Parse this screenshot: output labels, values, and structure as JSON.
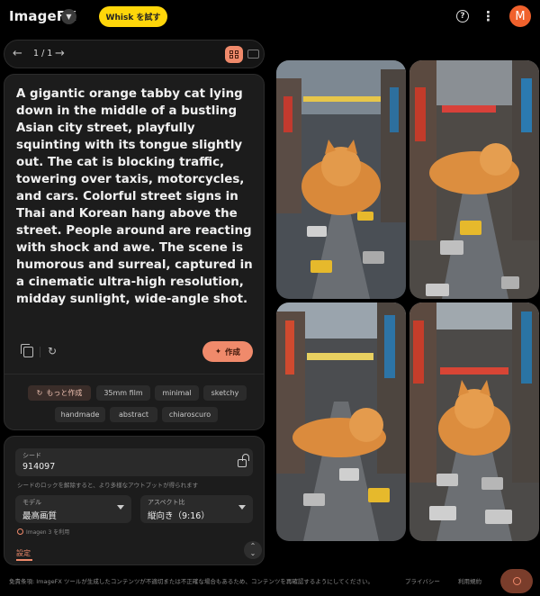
{
  "app": {
    "title": "ImageFX",
    "whisk_button": "Whisk を試す",
    "avatar_initial": "M",
    "accent_color": "#f08a6b",
    "whisk_color": "#ffd60a"
  },
  "pager": {
    "counter": "1 / 1",
    "prev_icon": "arrow-left-icon",
    "next_icon": "arrow-right-icon"
  },
  "prompt": {
    "text": "A gigantic orange tabby cat lying down in the middle of a bustling Asian city street, playfully squinting with its tongue slightly out. The cat is blocking traffic, towering over taxis, motorcycles, and cars. Colorful street signs in Thai and Korean hang above the street. People around are reacting with shock and awe. The scene is humorous and surreal, captured in a cinematic ultra-high resolution, midday sunlight, wide-angle shot.",
    "create_button": "作成"
  },
  "chips": {
    "more": "もっと作成",
    "items": [
      "35mm film",
      "minimal",
      "sketchy",
      "handmade",
      "abstract",
      "chiaroscuro"
    ]
  },
  "settings": {
    "seed_label": "シード",
    "seed_value": "914097",
    "seed_hint": "シードのロックを解除すると、より多様なアウトプットが得られます",
    "model_label": "モデル",
    "model_value": "最高画質",
    "aspect_label": "アスペクト比",
    "aspect_value": "縦向き（9:16）",
    "model_note": "Imagen 3 を利用",
    "tab_label": "設定"
  },
  "images": [
    {
      "alt": "generated-image-1"
    },
    {
      "alt": "generated-image-2"
    },
    {
      "alt": "generated-image-3"
    },
    {
      "alt": "generated-image-4"
    }
  ],
  "footer": {
    "disclaimer": "免責条項: ImageFX ツールが生成したコンテンツが不適切または不正確な場合もあるため、コンテンツを再確認するようにしてください。",
    "privacy": "プライバシー",
    "terms": "利用規約"
  }
}
